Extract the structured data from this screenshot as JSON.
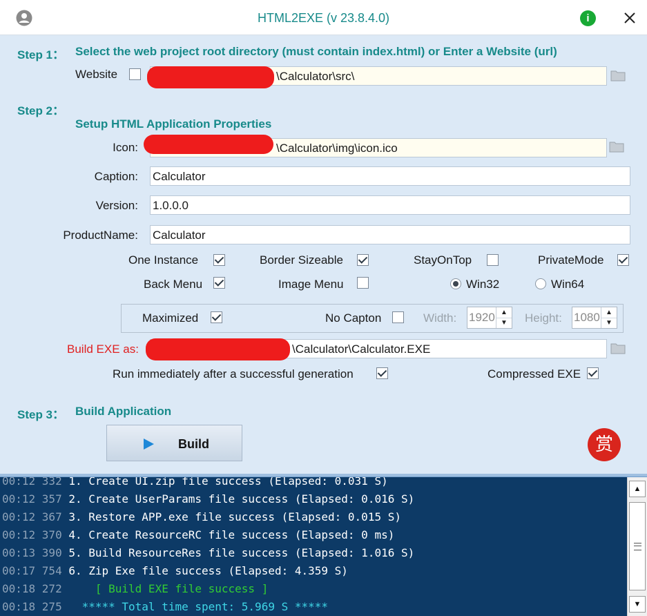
{
  "window": {
    "title": "HTML2EXE  (v 23.8.4.0)",
    "info_glyph": "i",
    "icons": [
      "user-icon",
      "info-icon",
      "close-icon"
    ]
  },
  "step1": {
    "label": "Step  1：",
    "title": "Select the web project root directory (must contain index.html) or Enter a Website (url)",
    "website_label": "Website",
    "website_checked": false,
    "path_value": "\\Calculator\\src\\"
  },
  "step2": {
    "label": "Step  2：",
    "title": "Setup HTML Application Properties",
    "icon_label": "Icon:",
    "icon_value": "\\Calculator\\img\\icon.ico",
    "caption_label": "Caption:",
    "caption_value": "Calculator",
    "version_label": "Version:",
    "version_value": "1.0.0.0",
    "productname_label": "ProductName:",
    "productname_value": "Calculator",
    "options": {
      "one_instance": {
        "label": "One Instance",
        "checked": true
      },
      "border_sizeable": {
        "label": "Border Sizeable",
        "checked": true
      },
      "stay_on_top": {
        "label": "StayOnTop",
        "checked": false
      },
      "private_mode": {
        "label": "PrivateMode",
        "checked": true
      },
      "back_menu": {
        "label": "Back Menu",
        "checked": true
      },
      "image_menu": {
        "label": "Image Menu",
        "checked": false
      },
      "win32": {
        "label": "Win32",
        "selected": true
      },
      "win64": {
        "label": "Win64",
        "selected": false
      }
    },
    "window_options": {
      "maximized": {
        "label": "Maximized",
        "checked": true
      },
      "no_caption": {
        "label": "No Capton",
        "checked": false
      },
      "width_label": "Width:",
      "width_value": "1920",
      "height_label": "Height:",
      "height_value": "1080"
    },
    "build_as_label": "Build EXE as:",
    "build_as_value": "\\Calculator\\Calculator.EXE",
    "run_after_label": "Run immediately after a successful generation",
    "run_after_checked": true,
    "compressed_label": "Compressed EXE",
    "compressed_checked": true
  },
  "step3": {
    "label": "Step  3：",
    "title": "Build Application",
    "build_button": "Build",
    "reward_glyph": "赏"
  },
  "colors": {
    "accent_teal": "#178a8a",
    "build_as_red": "#e02020",
    "log_background": "#0d3a66",
    "log_green": "#33cc33",
    "log_cyan": "#3fd6e6"
  },
  "log": [
    {
      "ts": "00:12 332",
      "msg": " 1. Create UI.zip file success (Elapsed: 0.031 S)",
      "style": "normal"
    },
    {
      "ts": "00:12 357",
      "msg": " 2. Create UserParams file success (Elapsed: 0.016 S)",
      "style": "normal"
    },
    {
      "ts": "00:12 367",
      "msg": " 3. Restore APP.exe file success (Elapsed: 0.015 S)",
      "style": "normal"
    },
    {
      "ts": "00:12 370",
      "msg": " 4. Create ResourceRC file success (Elapsed: 0 ms)",
      "style": "normal"
    },
    {
      "ts": "00:13 390",
      "msg": " 5. Build ResourceRes file success (Elapsed: 1.016 S)",
      "style": "normal"
    },
    {
      "ts": "00:17 754",
      "msg": " 6. Zip Exe file success (Elapsed: 4.359 S)",
      "style": "normal"
    },
    {
      "ts": "00:18 272",
      "msg": "     [ Build EXE file success ]",
      "style": "green"
    },
    {
      "ts": "00:18 275",
      "msg": "   ***** Total time spent: 5.969 S *****",
      "style": "cyan"
    }
  ]
}
